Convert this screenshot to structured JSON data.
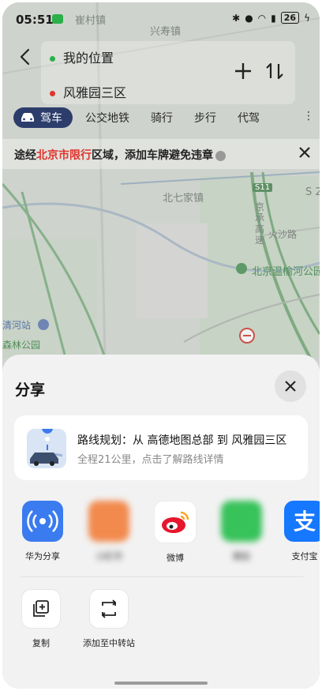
{
  "status_bar": {
    "time": "05:51",
    "battery": "26"
  },
  "map": {
    "labels": [
      "崔村镇",
      "兴寿镇",
      "北七家镇",
      "S11",
      "京承高速",
      "火沙路",
      "S 2",
      "北京温榆河公园",
      "清河站",
      "森林公园"
    ]
  },
  "route": {
    "origin": "我的位置",
    "destination": "风雅园三区"
  },
  "mode_tabs": [
    {
      "label": "驾车",
      "active": true
    },
    {
      "label": "公交地铁",
      "active": false
    },
    {
      "label": "骑行",
      "active": false
    },
    {
      "label": "步行",
      "active": false
    },
    {
      "label": "代驾",
      "active": false
    }
  ],
  "more_label": "⋮",
  "banner": {
    "prefix": "途经",
    "highlight": "北京市限行",
    "suffix": "区域，添加车牌避免违章"
  },
  "share": {
    "title": "分享",
    "card_title": "路线规划：从 高德地图总部 到 风雅园三区",
    "card_subtitle": "全程21公里，点击了解路线详情",
    "apps": [
      {
        "label": "华为分享",
        "color": "#3a7bf0"
      },
      {
        "label": "小红书",
        "color": "#f28a4d"
      },
      {
        "label": "微博",
        "color": "#ffffff"
      },
      {
        "label": "微信",
        "color": "#37c25a"
      },
      {
        "label": "支付宝",
        "color": "#1677ff"
      }
    ],
    "actions": [
      {
        "label": "复制"
      },
      {
        "label": "添加至中转站"
      }
    ]
  },
  "colors": {
    "accent": "#2c3d6c",
    "warning": "#e0342b"
  }
}
